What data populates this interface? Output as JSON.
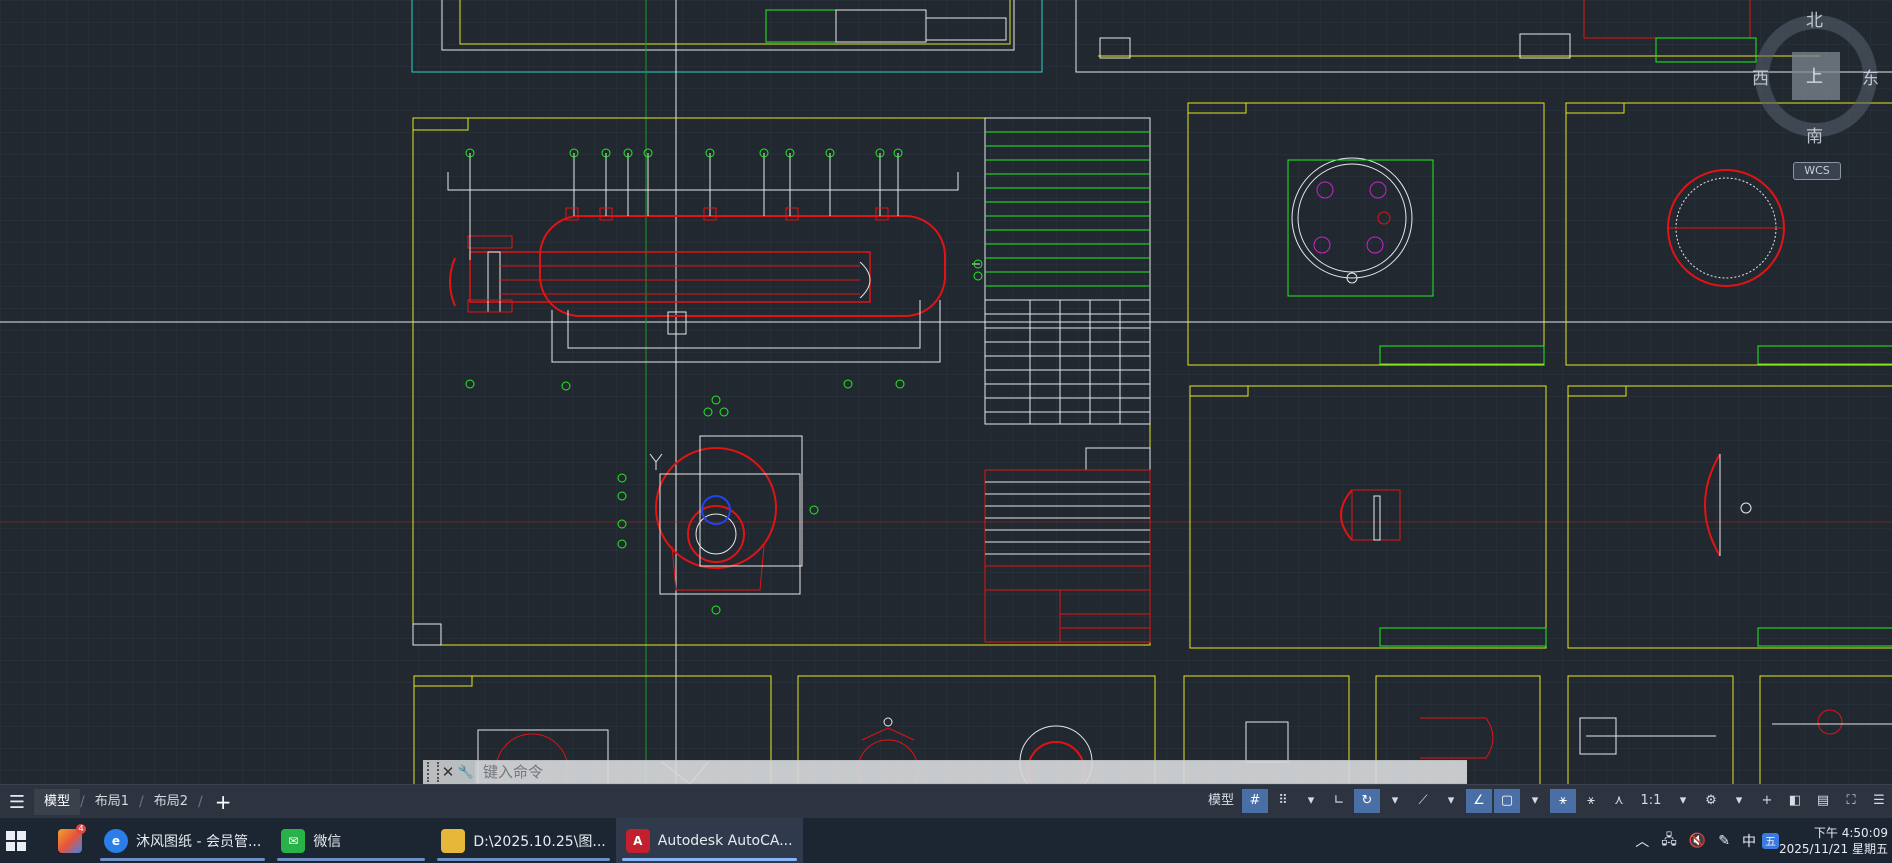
{
  "viewcube": {
    "north": "北",
    "south": "南",
    "east": "东",
    "west": "西",
    "top": "上",
    "wcs_label": "WCS"
  },
  "command": {
    "prompt": "键入命令"
  },
  "layout_tabs": {
    "menu_icon": "menu-icon",
    "tabs": [
      {
        "label": "模型"
      },
      {
        "label": "布局1"
      },
      {
        "label": "布局2"
      }
    ],
    "add_label": "+"
  },
  "status_bar": {
    "model_label": "模型",
    "scale_label": "1:1"
  },
  "taskbar": {
    "items": [
      {
        "label": "沐风图纸 - 会员管...",
        "icon": "browser-icon"
      },
      {
        "label": "微信",
        "icon": "wechat-icon"
      },
      {
        "label": "D:\\2025.10.25\\图...",
        "icon": "folder-icon"
      },
      {
        "label": "Autodesk AutoCA...",
        "icon": "autocad-icon"
      }
    ],
    "app_badge": "4",
    "tray_ime": "中",
    "clock_time": "下午 4:50:09",
    "clock_date": "2025/11/21 星期五"
  },
  "colors": {
    "canvas_bg": "#212830",
    "grid": "#2b333d",
    "frame_yellow": "#e6e61a",
    "red": "#e01414",
    "green": "#22ee22",
    "white": "#e8e8e8",
    "cyan": "#22d0d0"
  }
}
